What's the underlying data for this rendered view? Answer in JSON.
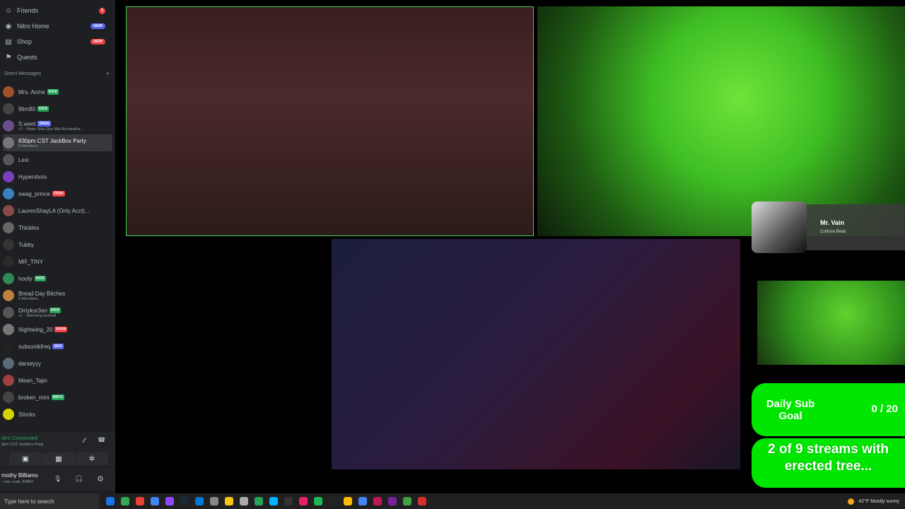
{
  "sidebar": {
    "nav": [
      {
        "icon": "friends-icon",
        "label": "Friends",
        "badge": "1",
        "badge_type": "num"
      },
      {
        "icon": "nitro-icon",
        "label": "Nitro Home",
        "badge": "NEW",
        "badge_type": "purple"
      },
      {
        "icon": "shop-icon",
        "label": "Shop",
        "badge": "NEW",
        "badge_type": "red"
      },
      {
        "icon": "quests-icon",
        "label": "Quests",
        "badge": "",
        "badge_type": "none"
      }
    ],
    "dm_header": "Direct Messages",
    "dm_add": "+",
    "dms": [
      {
        "name": "Mrs. Acme",
        "tag": "KICK",
        "tag_color": "#23a55a",
        "sub": "",
        "avatar": "#a0522d"
      },
      {
        "name": "9tim80",
        "tag": "KICK",
        "tag_color": "#23a55a",
        "sub": "",
        "avatar": "#444"
      },
      {
        "name": "S.weet",
        "tag": "SWEE",
        "tag_color": "#5865f2",
        "sub": "+2 · Mejor Sola Que Mal Acompaña...",
        "avatar": "#6b4f8a"
      },
      {
        "name": "830pm CST JackBox Party",
        "tag": "",
        "tag_color": "",
        "sub": "8 Members",
        "avatar": "#777",
        "active": true
      },
      {
        "name": "Lexi",
        "tag": "",
        "tag_color": "",
        "sub": "",
        "avatar": "#555"
      },
      {
        "name": "Hypershotv",
        "tag": "",
        "tag_color": "",
        "sub": "",
        "avatar": "#7a3fbf"
      },
      {
        "name": "swag_prince",
        "tag": "FRSH",
        "tag_color": "#f23f43",
        "sub": "",
        "avatar": "#3a7fbf"
      },
      {
        "name": "LaurenShayLA (Only Acct)...",
        "tag": "",
        "tag_color": "",
        "sub": "",
        "avatar": "#8b4a4a"
      },
      {
        "name": "Thickles",
        "tag": "",
        "tag_color": "",
        "sub": "",
        "avatar": "#666"
      },
      {
        "name": "Tubby",
        "tag": "",
        "tag_color": "",
        "sub": "",
        "avatar": "#333"
      },
      {
        "name": "MR_TINY",
        "tag": "",
        "tag_color": "",
        "sub": "",
        "avatar": "#2a2a2a"
      },
      {
        "name": "hoofy",
        "tag": "KICK",
        "tag_color": "#23a55a",
        "sub": "",
        "avatar": "#2e8b57"
      },
      {
        "name": "Bread Day Bitches",
        "tag": "",
        "tag_color": "",
        "sub": "9 Members",
        "avatar": "#c08040"
      },
      {
        "name": "Dirtykor3an",
        "tag": "KICK",
        "tag_color": "#23a55a",
        "sub": "+1 · Watching football",
        "avatar": "#555"
      },
      {
        "name": "Nightwing_20",
        "tag": "RVXN",
        "tag_color": "#f23f43",
        "sub": "",
        "avatar": "#777"
      },
      {
        "name": "subsonikfreq",
        "tag": "SEXI",
        "tag_color": "#5865f2",
        "sub": "",
        "avatar": "#222"
      },
      {
        "name": "darseyyy",
        "tag": "",
        "tag_color": "",
        "sub": "",
        "avatar": "#5c6b7a"
      },
      {
        "name": "Mean_Tajin",
        "tag": "",
        "tag_color": "",
        "sub": "",
        "avatar": "#a04040"
      },
      {
        "name": "broken_mini",
        "tag": "MAYO",
        "tag_color": "#23a55a",
        "sub": "",
        "avatar": "#444"
      },
      {
        "name": "Stocks",
        "tag": "",
        "tag_color": "",
        "sub": "",
        "avatar": "#d4d400"
      }
    ],
    "voice": {
      "status": "deo Connected",
      "channel": "0pm CST JackBox Party"
    },
    "user": {
      "name": "mothy Billiams",
      "status": "• Use code JIMBO"
    }
  },
  "overlay": {
    "webcam_name": "Mr. Vain",
    "webcam_role": "Culture Beat",
    "sub_goal_label": "Daily Sub Goal",
    "sub_goal_value": "0 / 20",
    "banner": "2 of 9 streams with erected tree..."
  },
  "taskbar": {
    "search_placeholder": "Type here to search",
    "weather": "42°F  Mostly sunny",
    "apps": [
      "#1a73e8",
      "#34a853",
      "#ea4335",
      "#4285f4",
      "#9147ff",
      "#1b2838",
      "#0078d4",
      "#888",
      "#f5c518",
      "#aaa",
      "#23a55a",
      "#00b2ff",
      "#333",
      "#e91e63",
      "#1db954",
      "#222",
      "#fbbc05",
      "#4285f4",
      "#c2185b",
      "#7b1fa2",
      "#43a047",
      "#d32f2f"
    ]
  }
}
